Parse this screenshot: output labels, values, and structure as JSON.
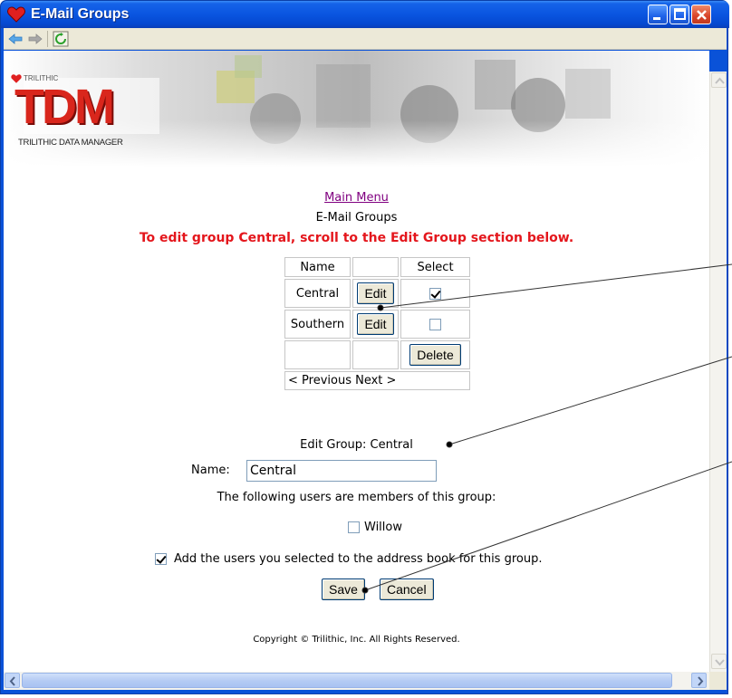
{
  "window": {
    "title": "E-Mail Groups"
  },
  "banner": {
    "brand_small": "TRILITHIC",
    "logo": "TDM",
    "tagline": "TRILITHIC DATA MANAGER"
  },
  "nav": {
    "main_menu": "Main Menu"
  },
  "page": {
    "subtitle": "E-Mail Groups",
    "warning": "To edit group Central, scroll to the Edit Group section below."
  },
  "groups_table": {
    "headers": [
      "Name",
      "",
      "Select"
    ],
    "rows": [
      {
        "name": "Central",
        "edit_label": "Edit",
        "selected": true
      },
      {
        "name": "Southern",
        "edit_label": "Edit",
        "selected": false
      }
    ],
    "delete_label": "Delete",
    "pager": "< Previous Next >"
  },
  "edit_group": {
    "title": "Edit Group: Central",
    "name_label": "Name:",
    "name_value": "Central",
    "members_text": "The following users are members of this group:",
    "member": {
      "name": "Willow",
      "checked": false
    },
    "add_to_address_book": {
      "label": "Add the users you selected to the address book for this group.",
      "checked": true
    },
    "save_label": "Save",
    "cancel_label": "Cancel"
  },
  "footer": {
    "copyright": "Copyright © Trilithic, Inc. All Rights Reserved."
  },
  "colors": {
    "warning": "#e4161c",
    "link_visited": "#800080",
    "logo_red": "#d9261c",
    "titlebar": "#0a55e0"
  }
}
